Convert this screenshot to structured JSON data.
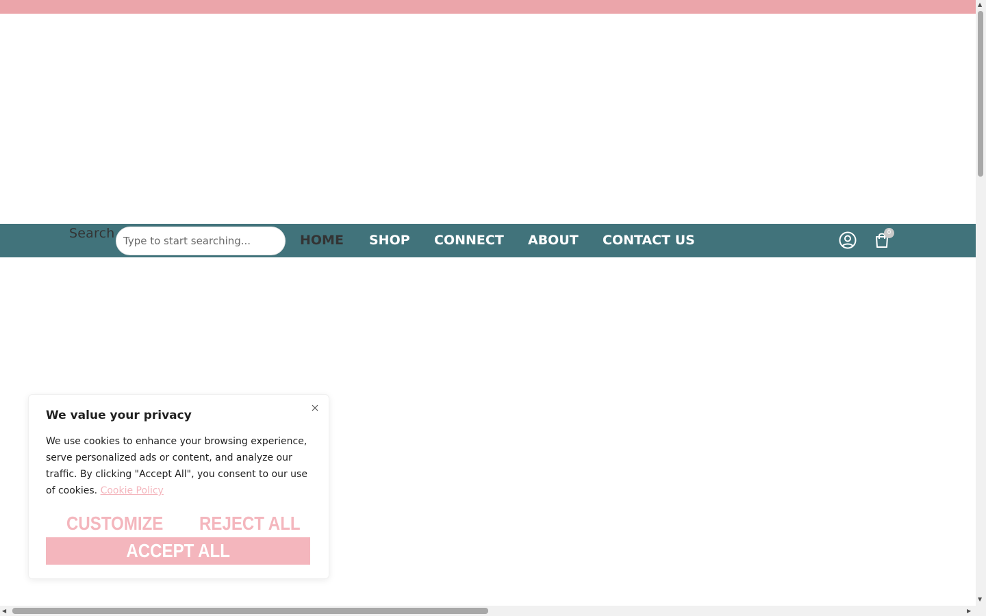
{
  "colors": {
    "top_bar": "#eba5aa",
    "nav_bar": "#41737b",
    "accent_pink": "#f4b6bd",
    "nav_active": "#333333",
    "badge_bg": "#c9c9c9",
    "badge_text": "#ffffff"
  },
  "header": {
    "search_label": "Search",
    "search_placeholder": "Type to start searching...",
    "search_value": "",
    "nav": [
      {
        "label": "HOME",
        "active": true
      },
      {
        "label": "SHOP",
        "active": false
      },
      {
        "label": "CONNECT",
        "active": false
      },
      {
        "label": "ABOUT",
        "active": false
      },
      {
        "label": "CONTACT US",
        "active": false
      }
    ],
    "account_icon": "user-circle-icon",
    "cart_icon": "shopping-bag-icon",
    "cart_count": "0"
  },
  "cookie_banner": {
    "title": "We value your privacy",
    "body": "We use cookies to enhance your browsing experience, serve personalized ads or content, and analyze our traffic. By clicking \"Accept All\", you consent to our use of cookies.",
    "policy_link": "Cookie Policy",
    "customize_label": "CUSTOMIZE",
    "reject_label": "REJECT ALL",
    "accept_label": "ACCEPT ALL",
    "close_icon": "close-icon"
  }
}
